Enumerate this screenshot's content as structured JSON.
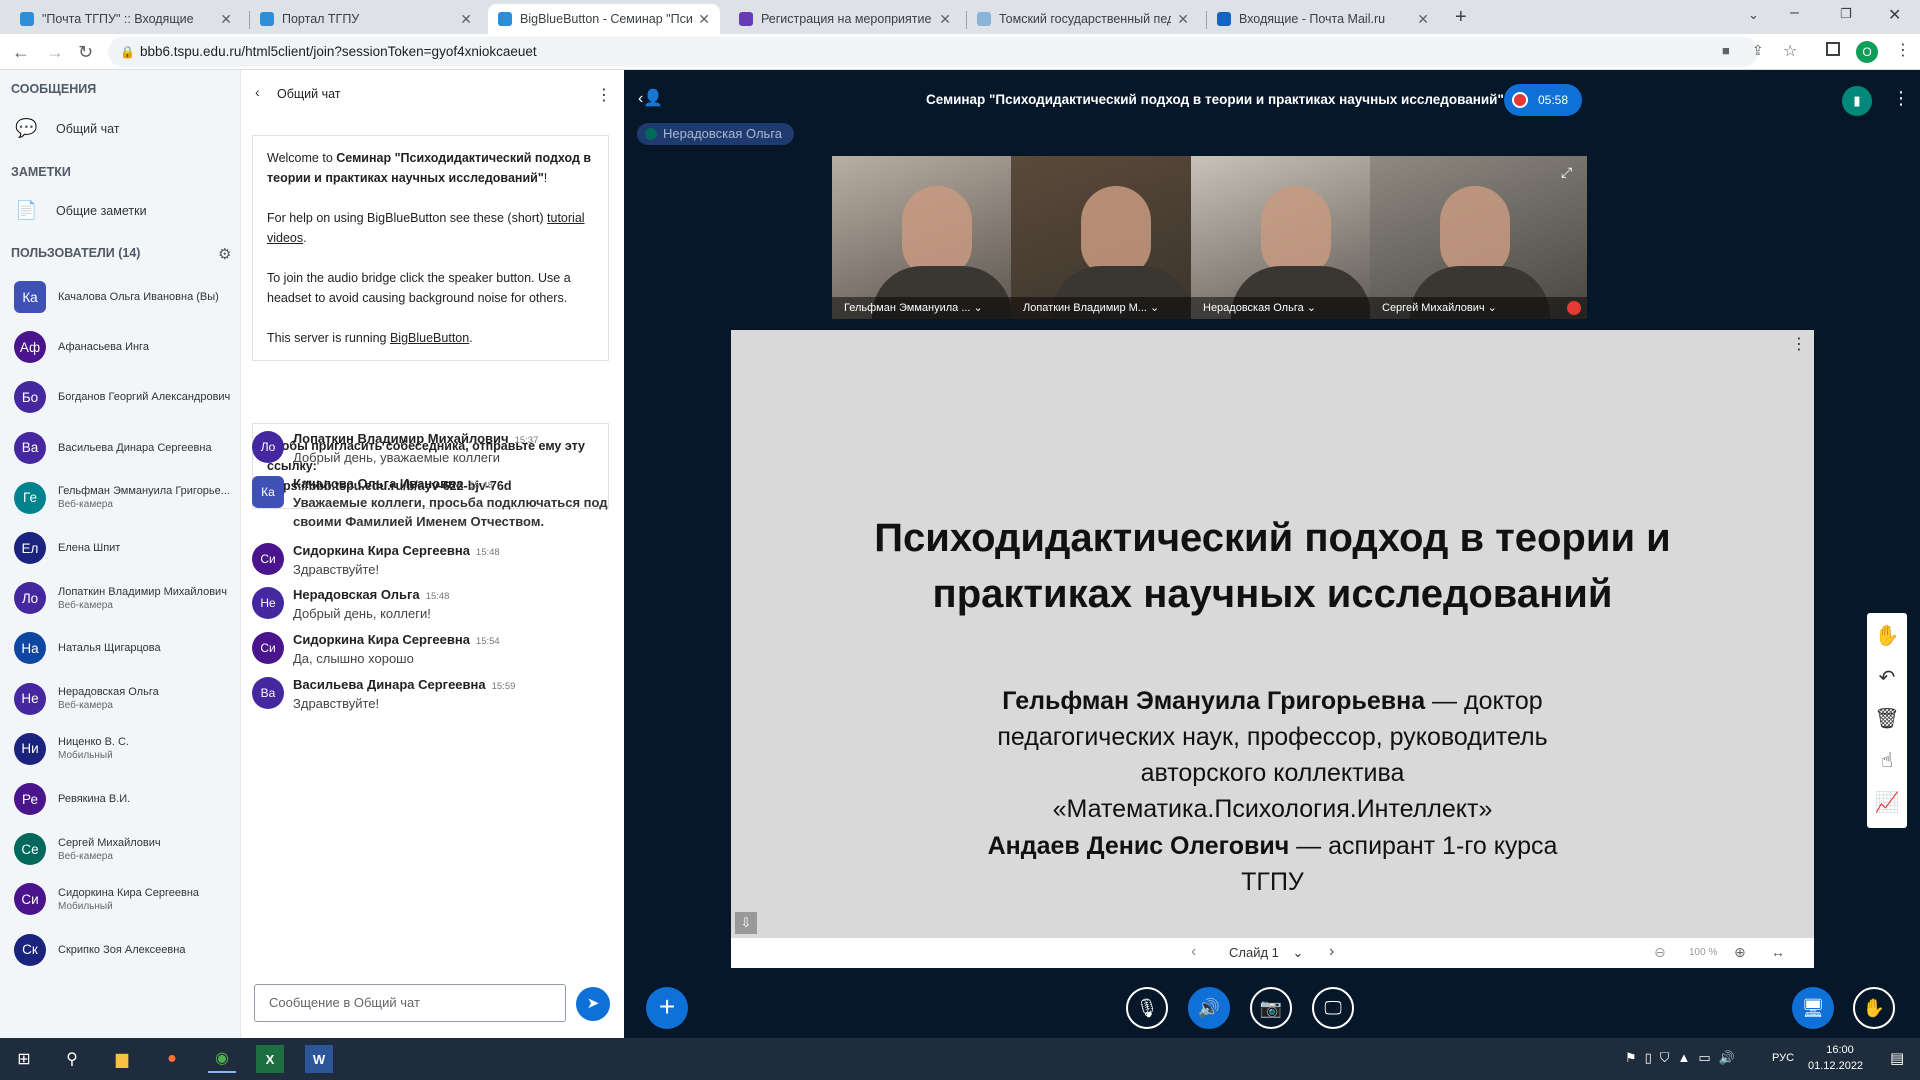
{
  "browser": {
    "tabs": [
      {
        "title": "\"Почта ТГПУ\" :: Входящие",
        "color": "#2a8fd8"
      },
      {
        "title": "Портал ТГПУ",
        "color": "#2a8fd8"
      },
      {
        "title": "BigBlueButton - Семинар \"Пси",
        "color": "#2a8fd8",
        "active": true
      },
      {
        "title": "Регистрация на мероприятие -",
        "color": "#673ab7"
      },
      {
        "title": "Томский государственный пед",
        "color": "#8ab4d8"
      },
      {
        "title": "Входящие - Почта Mail.ru",
        "color": "#1565c0"
      }
    ],
    "url": "bbb6.tspu.edu.ru/html5client/join?sessionToken=gyof4xniokcaeuet",
    "profile_initial": "O"
  },
  "left": {
    "messages_header": "СООБЩЕНИЯ",
    "public_chat": "Общий чат",
    "notes_header": "ЗАМЕТКИ",
    "shared_notes": "Общие заметки",
    "users_header": "ПОЛЬЗОВАТЕЛИ (14)",
    "users": [
      {
        "initials": "Ка",
        "name": "Качалова Ольга Ивановна (Вы)",
        "sub": "",
        "color": "#3f51b5",
        "status": "#e53935",
        "square": true
      },
      {
        "initials": "Аф",
        "name": "Афанасьева Инга",
        "sub": "",
        "color": "#4a148c",
        "status": "#e53935"
      },
      {
        "initials": "Бо",
        "name": "Богданов Георгий Александрович",
        "sub": "",
        "color": "#4527a0",
        "status": "#00897b"
      },
      {
        "initials": "Ва",
        "name": "Васильева Динара Сергеевна",
        "sub": "",
        "color": "#4527a0",
        "status": "#e53935"
      },
      {
        "initials": "Ге",
        "name": "Гельфман Эммануила Григорье...",
        "sub": "Веб-камера",
        "color": "#00838f",
        "status": "#00897b"
      },
      {
        "initials": "Ел",
        "name": "Елена Шпит",
        "sub": "",
        "color": "#1a237e",
        "status": "#00897b"
      },
      {
        "initials": "Ло",
        "name": "Лопаткин Владимир Михайлович",
        "sub": "Веб-камера",
        "color": "#4527a0",
        "status": "#e53935"
      },
      {
        "initials": "На",
        "name": "Наталья Щигарцова",
        "sub": "",
        "color": "#0d47a1",
        "status": ""
      },
      {
        "initials": "Не",
        "name": "Нерадовская Ольга",
        "sub": "Веб-камера",
        "color": "#4527a0",
        "status": "#00897b"
      },
      {
        "initials": "Ни",
        "name": "Ниценко В. С.",
        "sub": "Мобильный",
        "color": "#1a237e",
        "status": "#00897b"
      },
      {
        "initials": "Ре",
        "name": "Ревякина В.И.",
        "sub": "",
        "color": "#4a148c",
        "status": "#e53935"
      },
      {
        "initials": "Се",
        "name": "Сергей Михайлович",
        "sub": "Веб-камера",
        "color": "#00695c",
        "status": "#e53935"
      },
      {
        "initials": "Си",
        "name": "Сидоркина Кира Сергеевна",
        "sub": "Мобильный",
        "color": "#4a148c",
        "status": "#00897b"
      },
      {
        "initials": "Ск",
        "name": "Скрипко Зоя Алексеевна",
        "sub": "",
        "color": "#1a237e",
        "status": "#e53935"
      }
    ]
  },
  "chat": {
    "title": "Общий чат",
    "welcome_prefix": "Welcome to ",
    "welcome_bold": "Семинар \"Психодидактический подход в теории и практиках научных исследований\"",
    "welcome_suffix": "!",
    "help_prefix": "For help on using BigBlueButton see these (short) ",
    "help_link": "tutorial videos",
    "help_suffix": ".",
    "audio_text": "To join the audio bridge click the speaker button. Use a headset to avoid causing background noise for others.",
    "server_prefix": "This server is running ",
    "server_link": "BigBlueButton",
    "server_suffix": ".",
    "invite_text": "Чтобы пригласить собеседника, отправьте ему эту ссылку:",
    "invite_link": "https://bbb.tspu.edu.ru/b/ayv-622-bjv-76d",
    "messages": [
      {
        "initials": "Ло",
        "name": "Лопаткин Владимир Михайлович",
        "time": "15:37",
        "text": "Добрый день, уважаемые коллеги",
        "color": "#4527a0",
        "bold": false
      },
      {
        "initials": "Ка",
        "name": "Качалова Ольга Ивановна",
        "time": "15:48",
        "text": "Уважаемые коллеги, просьба подключаться под своими Фамилией Именем Отчеством.",
        "color": "#3f51b5",
        "bold": true,
        "square": true
      },
      {
        "initials": "Си",
        "name": "Сидоркина Кира Сергеевна",
        "time": "15:48",
        "text": "Здравствуйте!",
        "color": "#4a148c",
        "bold": false
      },
      {
        "initials": "Не",
        "name": "Нерадовская Ольга",
        "time": "15:48",
        "text": "Добрый день, коллеги!",
        "color": "#4527a0",
        "bold": false
      },
      {
        "initials": "Си",
        "name": "Сидоркина Кира Сергеевна",
        "time": "15:54",
        "text": "Да, слышно хорошо",
        "color": "#4a148c",
        "bold": false
      },
      {
        "initials": "Ва",
        "name": "Васильева Динара Сергеевна",
        "time": "15:59",
        "text": "Здравствуйте!",
        "color": "#4527a0",
        "bold": false
      }
    ],
    "input_placeholder": "Сообщение в Общий чат"
  },
  "meeting": {
    "title": "Семинар \"Психодидактический подход в теории и практиках научных исследований\"",
    "timer": "05:58",
    "talker": "Нерадовская Ольга",
    "videos": [
      {
        "name": "Гельфман Эммануила ...",
        "mic": "#00897b",
        "bg": "#b9aea3"
      },
      {
        "name": "Лопаткин Владимир М...",
        "mic": "#e53935",
        "bg": "#5a4a3a"
      },
      {
        "name": "Нерадовская Ольга",
        "mic": "#00897b",
        "bg": "#c8c2b8"
      },
      {
        "name": "Сергей Михайлович",
        "mic": "#e53935",
        "bg": "#8e8a82"
      }
    ],
    "slide": {
      "title": "Психодидактический подход в теории и практиках научных исследований",
      "author1_bold": "Гельфман Эмануила Григорьевна",
      "author1_rest": " — доктор педагогических наук, профессор, руководитель авторского коллектива «Математика.Психология.Интеллект»",
      "author2_bold": "Андаев Денис Олегович",
      "author2_rest": " — аспирант 1-го курса ТГПУ"
    },
    "slide_label": "Слайд 1",
    "zoom": "100 %"
  },
  "taskbar": {
    "lang": "РУС",
    "time": "16:00",
    "date": "01.12.2022"
  }
}
